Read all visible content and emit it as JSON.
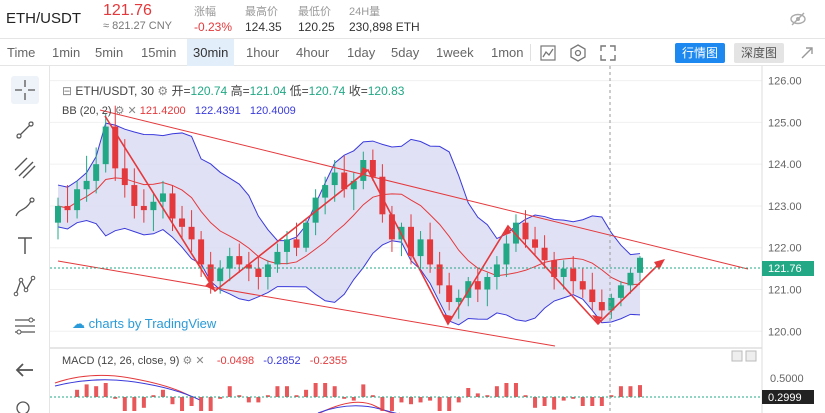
{
  "header": {
    "pair": "ETH/USDT",
    "price": "121.76",
    "price_cny": "≈ 821.27 CNY",
    "stats": [
      {
        "label": "涨幅",
        "value": "-0.23%",
        "color": "red"
      },
      {
        "label": "最高价",
        "value": "124.35",
        "color": "dark"
      },
      {
        "label": "最低价",
        "value": "120.25",
        "color": "dark"
      },
      {
        "label": "24H量",
        "value": "230,898 ETH",
        "color": "dark"
      }
    ]
  },
  "toolbar": {
    "timeframes": [
      "Time",
      "1min",
      "5min",
      "15min",
      "30min",
      "1hour",
      "4hour",
      "1day",
      "5day",
      "1week",
      "1mon"
    ],
    "active_timeframe": "30min",
    "view_buttons": [
      "行情图",
      "深度图"
    ],
    "active_view": "行情图"
  },
  "legend": {
    "symbol": "ETH/USDT, 30",
    "open_label": "开=",
    "open": "120.74",
    "high_label": "高=",
    "high": "121.04",
    "low_label": "低=",
    "low": "120.74",
    "close_label": "收=",
    "close": "120.83",
    "bb_label": "BB (20, 2)",
    "bb_values": [
      "121.4200",
      "122.4391",
      "120.4009"
    ],
    "macd_label": "MACD (12, 26, close, 9)",
    "macd_values": [
      "-0.0498",
      "-0.2852",
      "-0.2355"
    ],
    "watermark": "charts by TradingView"
  },
  "chart_data": {
    "type": "candlestick",
    "interval": "30",
    "price_axis_ticks": [
      "126.00",
      "125.00",
      "124.00",
      "123.00",
      "122.00",
      "121.00",
      "120.00"
    ],
    "current_price_tag": "121.76",
    "macd_axis_ticks": [
      "0.5000"
    ],
    "macd_current_tag": "0.2999",
    "candles": [
      [
        122.6,
        123.2,
        122.2,
        123.0
      ],
      [
        123.0,
        123.5,
        122.6,
        122.9
      ],
      [
        122.9,
        123.6,
        122.7,
        123.4
      ],
      [
        123.4,
        124.2,
        123.1,
        123.6
      ],
      [
        123.6,
        124.4,
        123.3,
        124.0
      ],
      [
        124.0,
        125.2,
        123.8,
        124.9
      ],
      [
        124.9,
        125.4,
        123.6,
        123.9
      ],
      [
        123.9,
        124.6,
        123.2,
        123.5
      ],
      [
        123.5,
        123.9,
        122.7,
        123.0
      ],
      [
        123.0,
        123.4,
        122.6,
        122.9
      ],
      [
        122.9,
        123.3,
        122.4,
        123.1
      ],
      [
        123.1,
        123.6,
        122.7,
        123.3
      ],
      [
        123.3,
        123.5,
        122.4,
        122.7
      ],
      [
        122.7,
        123.0,
        122.2,
        122.5
      ],
      [
        122.5,
        122.9,
        121.9,
        122.2
      ],
      [
        122.2,
        122.4,
        121.3,
        121.6
      ],
      [
        121.6,
        121.9,
        120.9,
        121.2
      ],
      [
        121.2,
        121.7,
        120.9,
        121.5
      ],
      [
        121.5,
        122.0,
        121.2,
        121.8
      ],
      [
        121.8,
        122.1,
        121.4,
        121.6
      ],
      [
        121.6,
        121.9,
        121.2,
        121.5
      ],
      [
        121.5,
        121.8,
        121.0,
        121.3
      ],
      [
        121.3,
        121.7,
        121.0,
        121.6
      ],
      [
        121.6,
        122.1,
        121.4,
        121.9
      ],
      [
        121.9,
        122.4,
        121.6,
        122.2
      ],
      [
        122.2,
        122.6,
        121.8,
        122.0
      ],
      [
        122.0,
        122.7,
        121.9,
        122.6
      ],
      [
        122.6,
        123.4,
        122.3,
        123.2
      ],
      [
        123.2,
        123.7,
        122.8,
        123.5
      ],
      [
        123.5,
        124.1,
        123.1,
        123.8
      ],
      [
        123.8,
        124.2,
        123.2,
        123.4
      ],
      [
        123.4,
        123.8,
        122.9,
        123.6
      ],
      [
        123.6,
        124.3,
        123.4,
        124.1
      ],
      [
        124.1,
        124.35,
        123.6,
        123.7
      ],
      [
        123.7,
        124.0,
        122.6,
        122.8
      ],
      [
        122.8,
        123.0,
        121.9,
        122.2
      ],
      [
        122.2,
        122.6,
        121.8,
        122.5
      ],
      [
        122.5,
        122.8,
        121.6,
        121.8
      ],
      [
        121.8,
        122.4,
        121.5,
        122.2
      ],
      [
        122.2,
        122.6,
        121.4,
        121.6
      ],
      [
        121.6,
        121.9,
        120.9,
        121.1
      ],
      [
        121.1,
        121.4,
        120.5,
        120.7
      ],
      [
        120.7,
        121.0,
        120.3,
        120.8
      ],
      [
        120.8,
        121.3,
        120.6,
        121.2
      ],
      [
        121.2,
        121.5,
        120.7,
        121.0
      ],
      [
        121.0,
        121.4,
        120.6,
        121.3
      ],
      [
        121.3,
        121.8,
        121.0,
        121.6
      ],
      [
        121.6,
        122.3,
        121.3,
        122.1
      ],
      [
        122.1,
        122.8,
        121.9,
        122.6
      ],
      [
        122.6,
        122.9,
        122.0,
        122.2
      ],
      [
        122.2,
        122.5,
        121.8,
        122.0
      ],
      [
        122.0,
        122.3,
        121.5,
        121.7
      ],
      [
        121.7,
        121.9,
        121.0,
        121.3
      ],
      [
        121.3,
        121.7,
        121.0,
        121.5
      ],
      [
        121.5,
        121.8,
        120.9,
        121.2
      ],
      [
        121.2,
        121.5,
        120.8,
        121.0
      ],
      [
        121.0,
        121.4,
        120.5,
        120.7
      ],
      [
        120.7,
        121.0,
        120.25,
        120.5
      ],
      [
        120.5,
        120.9,
        120.3,
        120.8
      ],
      [
        120.8,
        121.2,
        120.6,
        121.1
      ],
      [
        121.1,
        121.5,
        120.9,
        121.4
      ],
      [
        121.4,
        121.8,
        121.2,
        121.76
      ]
    ]
  }
}
